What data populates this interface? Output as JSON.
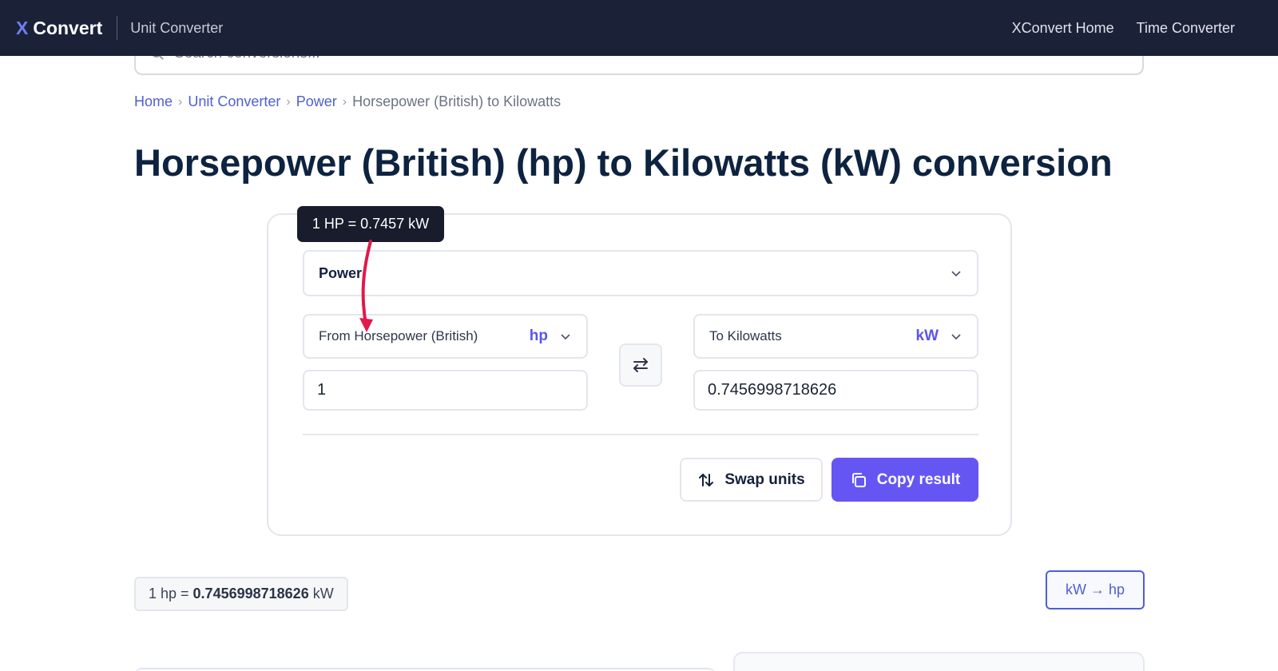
{
  "nav": {
    "brand_x": "X",
    "brand_name": "Convert",
    "brand_sub": "Unit Converter",
    "links": [
      "XConvert Home",
      "Time Converter"
    ]
  },
  "search": {
    "placeholder": "Search conversions..."
  },
  "breadcrumb": {
    "items": [
      "Home",
      "Unit Converter",
      "Power"
    ],
    "current": "Horsepower (British) to Kilowatts"
  },
  "page": {
    "title": "Horsepower (British) (hp) to Kilowatts (kW) conversion"
  },
  "converter": {
    "category": "Power",
    "from_label": "From Horsepower (British)",
    "from_abbr": "hp",
    "from_value": "1",
    "to_label": "To Kilowatts",
    "to_abbr": "kW",
    "to_value": "0.7456998718626",
    "swap_button": "Swap units",
    "copy_button": "Copy result"
  },
  "tooltip": {
    "text": "1 HP = 0.7457 kW"
  },
  "result": {
    "prefix": "1 hp =",
    "value": "0.7456998718626",
    "unit": "kW"
  },
  "reverse_link": {
    "label": "kW → hp"
  },
  "colors": {
    "nav_bg": "#1b2238",
    "accent": "#6556f4",
    "link": "#4f5fd1",
    "annotation_arrow": "#e0194a"
  }
}
